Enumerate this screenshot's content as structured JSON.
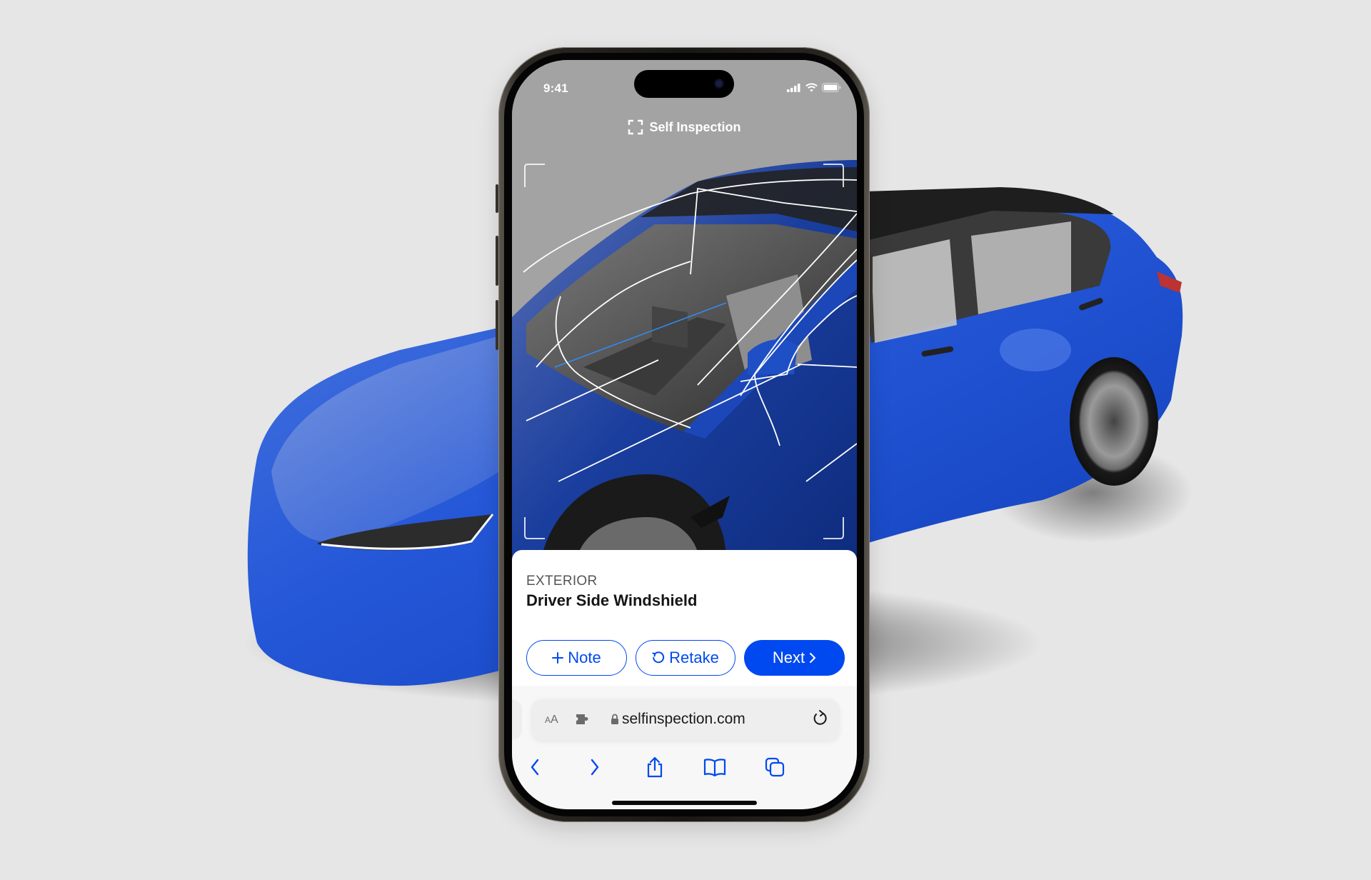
{
  "colors": {
    "background": "#E6E6E6",
    "car_blue": "#1F55D6",
    "accent": "#0049F0",
    "camera_overlay": "#A3A3A3",
    "card_bg": "#FFFFFF",
    "browser_bg": "#F7F7F7"
  },
  "status_bar": {
    "time": "9:41",
    "icons": [
      "signal-icon",
      "wifi-icon",
      "battery-icon"
    ]
  },
  "app": {
    "title": "Self Inspection",
    "title_icon": "scan-frame-icon"
  },
  "camera": {
    "guide": "windshield-outline-overlay",
    "frame_icon": "viewfinder-corners"
  },
  "card": {
    "category": "EXTERIOR",
    "title": "Driver Side Windshield",
    "buttons": {
      "note": {
        "icon": "plus-icon",
        "label": "Note"
      },
      "retake": {
        "icon": "retake-icon",
        "label": "Retake"
      },
      "next": {
        "label": "Next",
        "icon": "chevron-right-icon"
      }
    }
  },
  "browser": {
    "text_size_label_small": "A",
    "text_size_label_large": "A",
    "url": "selfinspection.com",
    "toolbar": [
      "back",
      "forward",
      "share",
      "bookmarks",
      "tabs"
    ]
  }
}
